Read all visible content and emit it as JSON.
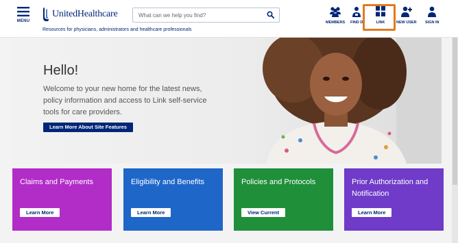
{
  "header": {
    "menu_label": "MENU",
    "logo_text": "UnitedHealthcare",
    "tagline": "Resources for physicians, administrators and healthcare professionals",
    "search_placeholder": "What can we help you find?"
  },
  "nav": [
    {
      "label": "MEMBERS",
      "icon": "members-icon"
    },
    {
      "label": "FIND D",
      "icon": "find-doctor-icon"
    },
    {
      "label": "LINK",
      "icon": "link-grid-icon"
    },
    {
      "label": "NEW USER",
      "icon": "new-user-icon"
    },
    {
      "label": "SIGN IN",
      "icon": "user-icon"
    }
  ],
  "hero": {
    "title": "Hello!",
    "text": "Welcome to your new home for the latest news, policy information and access to Link self-service tools for care providers.",
    "button": "Learn More About Site Features"
  },
  "cards": [
    {
      "title": "Claims and Payments",
      "button": "Learn More",
      "color": "#b22cc8"
    },
    {
      "title": "Eligibility and Benefits",
      "button": "Learn More",
      "color": "#1f66c9"
    },
    {
      "title": "Policies and Protocols",
      "button": "View Current",
      "color": "#1f8f3a"
    },
    {
      "title": "Prior Authorization and Notification",
      "button": "Learn More",
      "color": "#6f3bc8"
    }
  ],
  "colors": {
    "brand": "#002677",
    "highlight": "#e07a20"
  }
}
